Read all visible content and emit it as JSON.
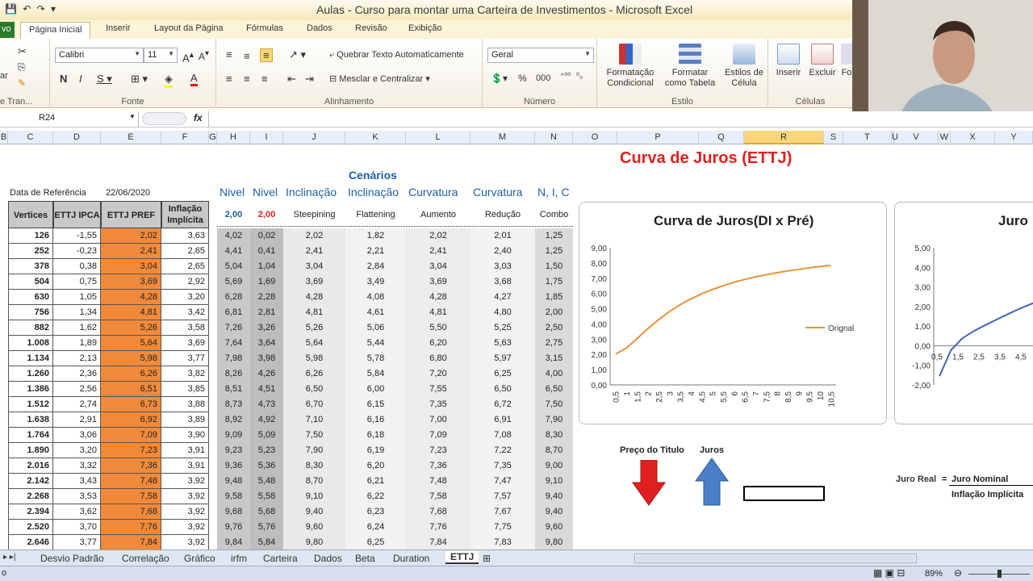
{
  "window": {
    "title": "Aulas - Curso para montar uma  Carteira de Investimentos  -  Microsoft Excel"
  },
  "tabs": [
    "vo",
    "Página Inicial",
    "Inserir",
    "Layout da Página",
    "Fórmulas",
    "Dados",
    "Revisão",
    "Exibição"
  ],
  "ribbon": {
    "clipboard_label": "e Tran...",
    "font_group": "Fonte",
    "font_name": "Calibri",
    "font_size": "11",
    "align_group": "Alinhamento",
    "wrap_text": "Quebrar Texto Automaticamente",
    "merge_center": "Mesclar e Centralizar",
    "number_group": "Número",
    "number_format": "Geral",
    "styles_group": "Estilo",
    "cond_format": "Formatação\nCondicional",
    "format_table": "Formatar\ncomo Tabela",
    "cell_styles": "Estilos de\nCélula",
    "insert": "Inserir",
    "delete": "Excluir",
    "format_short": "Fo",
    "cells_group": "Células",
    "colar": "ar"
  },
  "formula_bar": {
    "name_box": "R24",
    "fx": "fx",
    "value": ""
  },
  "columns": [
    "B",
    "C",
    "D",
    "E",
    "F",
    "G",
    "H",
    "I",
    "J",
    "K",
    "L",
    "M",
    "N",
    "O",
    "P",
    "Q",
    "R",
    "S",
    "T",
    "U",
    "V",
    "W",
    "X",
    "Y"
  ],
  "selected_column": "R",
  "sheet": {
    "title": "Curva de Juros (ETTJ)",
    "cenarios": "Cenários",
    "ref_label": "Data de Referência",
    "ref_date": "22/06/2020",
    "scenario_headers": [
      "Nivel",
      "Nivel",
      "Inclinação",
      "Inclinação",
      "Curvatura",
      "Curvatura",
      "N, I, C"
    ],
    "scenario_params": [
      "2,00",
      "2,00",
      "Steepining",
      "Flattening",
      "Aumento",
      "Redução",
      "Combo"
    ],
    "table_headers": [
      "Vertices",
      "ETTJ IPCA",
      "ETTJ PREF",
      "Inflação Implícita"
    ],
    "rows": [
      [
        "126",
        "-1,55",
        "2,02",
        "3,63",
        "4,02",
        "0,02",
        "2,02",
        "1,82",
        "2,02",
        "2,01",
        "1,25"
      ],
      [
        "252",
        "-0,23",
        "2,41",
        "2,65",
        "4,41",
        "0,41",
        "2,41",
        "2,21",
        "2,41",
        "2,40",
        "1,25"
      ],
      [
        "378",
        "0,38",
        "3,04",
        "2,65",
        "5,04",
        "1,04",
        "3,04",
        "2,84",
        "3,04",
        "3,03",
        "1,50"
      ],
      [
        "504",
        "0,75",
        "3,69",
        "2,92",
        "5,69",
        "1,69",
        "3,69",
        "3,49",
        "3,69",
        "3,68",
        "1,75"
      ],
      [
        "630",
        "1,05",
        "4,28",
        "3,20",
        "6,28",
        "2,28",
        "4,28",
        "4,08",
        "4,28",
        "4,27",
        "1,85"
      ],
      [
        "756",
        "1,34",
        "4,81",
        "3,42",
        "6,81",
        "2,81",
        "4,81",
        "4,61",
        "4,81",
        "4,80",
        "2,00"
      ],
      [
        "882",
        "1,62",
        "5,26",
        "3,58",
        "7,26",
        "3,26",
        "5,26",
        "5,06",
        "5,50",
        "5,25",
        "2,50"
      ],
      [
        "1.008",
        "1,89",
        "5,64",
        "3,69",
        "7,64",
        "3,64",
        "5,64",
        "5,44",
        "6,20",
        "5,63",
        "2,75"
      ],
      [
        "1.134",
        "2,13",
        "5,98",
        "3,77",
        "7,98",
        "3,98",
        "5,98",
        "5,78",
        "6,80",
        "5,97",
        "3,15"
      ],
      [
        "1.260",
        "2,36",
        "6,26",
        "3,82",
        "8,26",
        "4,26",
        "6,26",
        "5,84",
        "7,20",
        "6,25",
        "4,00"
      ],
      [
        "1.386",
        "2,56",
        "6,51",
        "3,85",
        "8,51",
        "4,51",
        "6,50",
        "6,00",
        "7,55",
        "6,50",
        "6,50"
      ],
      [
        "1.512",
        "2,74",
        "6,73",
        "3,88",
        "8,73",
        "4,73",
        "6,70",
        "6,15",
        "7,35",
        "6,72",
        "7,50"
      ],
      [
        "1.638",
        "2,91",
        "6,92",
        "3,89",
        "8,92",
        "4,92",
        "7,10",
        "6,16",
        "7,00",
        "6,91",
        "7,90"
      ],
      [
        "1.764",
        "3,06",
        "7,09",
        "3,90",
        "9,09",
        "5,09",
        "7,50",
        "6,18",
        "7,09",
        "7,08",
        "8,30"
      ],
      [
        "1.890",
        "3,20",
        "7,23",
        "3,91",
        "9,23",
        "5,23",
        "7,90",
        "6,19",
        "7,23",
        "7,22",
        "8,70"
      ],
      [
        "2.016",
        "3,32",
        "7,36",
        "3,91",
        "9,36",
        "5,36",
        "8,30",
        "6,20",
        "7,36",
        "7,35",
        "9,00"
      ],
      [
        "2.142",
        "3,43",
        "7,48",
        "3,92",
        "9,48",
        "5,48",
        "8,70",
        "6,21",
        "7,48",
        "7,47",
        "9,10"
      ],
      [
        "2.268",
        "3,53",
        "7,58",
        "3,92",
        "9,58",
        "5,58",
        "9,10",
        "6,22",
        "7,58",
        "7,57",
        "9,40"
      ],
      [
        "2.394",
        "3,62",
        "7,68",
        "3,92",
        "9,68",
        "5,68",
        "9,40",
        "6,23",
        "7,68",
        "7,67",
        "9,40"
      ],
      [
        "2.520",
        "3,70",
        "7,76",
        "3,92",
        "9,76",
        "5,76",
        "9,60",
        "6,24",
        "7,76",
        "7,75",
        "9,60"
      ],
      [
        "2.646",
        "3,77",
        "7,84",
        "3,92",
        "9,84",
        "5,84",
        "9,80",
        "6,25",
        "7,84",
        "7,83",
        "9,80"
      ]
    ],
    "preco_titulo": "Preço do Titulo",
    "juros": "Juros",
    "juro_real_label": "Juro Real",
    "eq": "=",
    "juro_nominal": "Juro Nominal",
    "inflacao_implicita": "Inflação Implícita",
    "accent_orange": "#f08a3a",
    "accent_red": "#e02020",
    "accent_blue": "#4a7fc8"
  },
  "chart_data": [
    {
      "type": "line",
      "title": "Curva de Juros(DI x Pré)",
      "series": [
        {
          "name": "Orignal",
          "values": [
            2.02,
            2.41,
            3.04,
            3.69,
            4.28,
            4.81,
            5.26,
            5.64,
            5.98,
            6.26,
            6.51,
            6.73,
            6.92,
            7.09,
            7.23,
            7.36,
            7.48,
            7.58,
            7.68,
            7.76,
            7.84
          ]
        }
      ],
      "x": [
        "0,5",
        "1",
        "1,5",
        "2",
        "2,5",
        "3",
        "3,5",
        "4",
        "4,5",
        "5",
        "5,5",
        "6",
        "6,5",
        "7",
        "7,5",
        "8",
        "8,5",
        "9",
        "9,5",
        "10",
        "10,5"
      ],
      "yticks": [
        "0,00",
        "1,00",
        "2,00",
        "3,00",
        "4,00",
        "5,00",
        "6,00",
        "7,00",
        "8,00",
        "9,00"
      ],
      "ylim": [
        0,
        9
      ],
      "color": "#e8913a"
    },
    {
      "type": "line",
      "title": "Juro",
      "series": [
        {
          "values": [
            -1.55,
            -0.23,
            0.38,
            0.75,
            1.05,
            1.34,
            1.62,
            1.89,
            2.13,
            2.36
          ]
        }
      ],
      "x": [
        "0,5",
        "1,5",
        "2,5",
        "3,5",
        "4,5"
      ],
      "yticks": [
        "-2,00",
        "-1,00",
        "0,00",
        "1,00",
        "2,00",
        "3,00",
        "4,00",
        "5,00"
      ],
      "ylim": [
        -2,
        5
      ],
      "color": "#3f66b8"
    }
  ],
  "sheet_tabs": [
    "Desvio Padrão",
    "Correlação",
    "Gráfico",
    "irfm",
    "Carteira",
    "Dados",
    "Beta",
    "Duration",
    "ETTJ"
  ],
  "active_sheet": "ETTJ",
  "status": {
    "mode": "o",
    "zoom": "89%"
  }
}
